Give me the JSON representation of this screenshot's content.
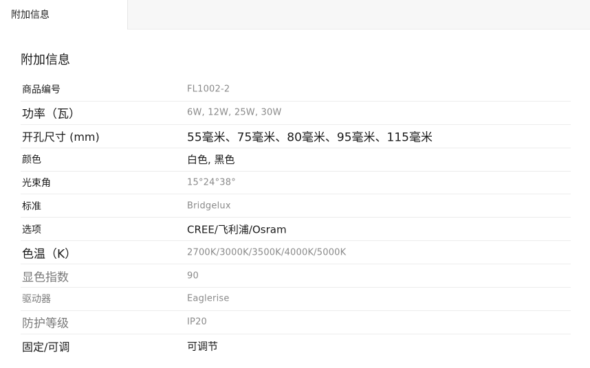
{
  "tabs": [
    {
      "label": "附加信息"
    }
  ],
  "section": {
    "title": "附加信息"
  },
  "specs": [
    {
      "label": "商品编号",
      "value": "FL1002-2"
    },
    {
      "label": "功率（瓦）",
      "value": "6W, 12W, 25W, 30W"
    },
    {
      "label": "开孔尺寸 (mm)",
      "value": "55毫米、75毫米、80毫米、95毫米、115毫米"
    },
    {
      "label": "颜色",
      "value": "白色, 黑色"
    },
    {
      "label": "光束角",
      "value": "15°24°38°"
    },
    {
      "label": "标准",
      "value": "Bridgelux"
    },
    {
      "label": "选项",
      "value": "CREE/飞利浦/Osram"
    },
    {
      "label": "色温（K）",
      "value": "2700K/3000K/3500K/4000K/5000K"
    },
    {
      "label": "显色指数",
      "value": "90"
    },
    {
      "label": "驱动器",
      "value": "Eaglerise"
    },
    {
      "label": "防护等级",
      "value": "IP20"
    },
    {
      "label": "固定/可调",
      "value": "可调节"
    }
  ]
}
